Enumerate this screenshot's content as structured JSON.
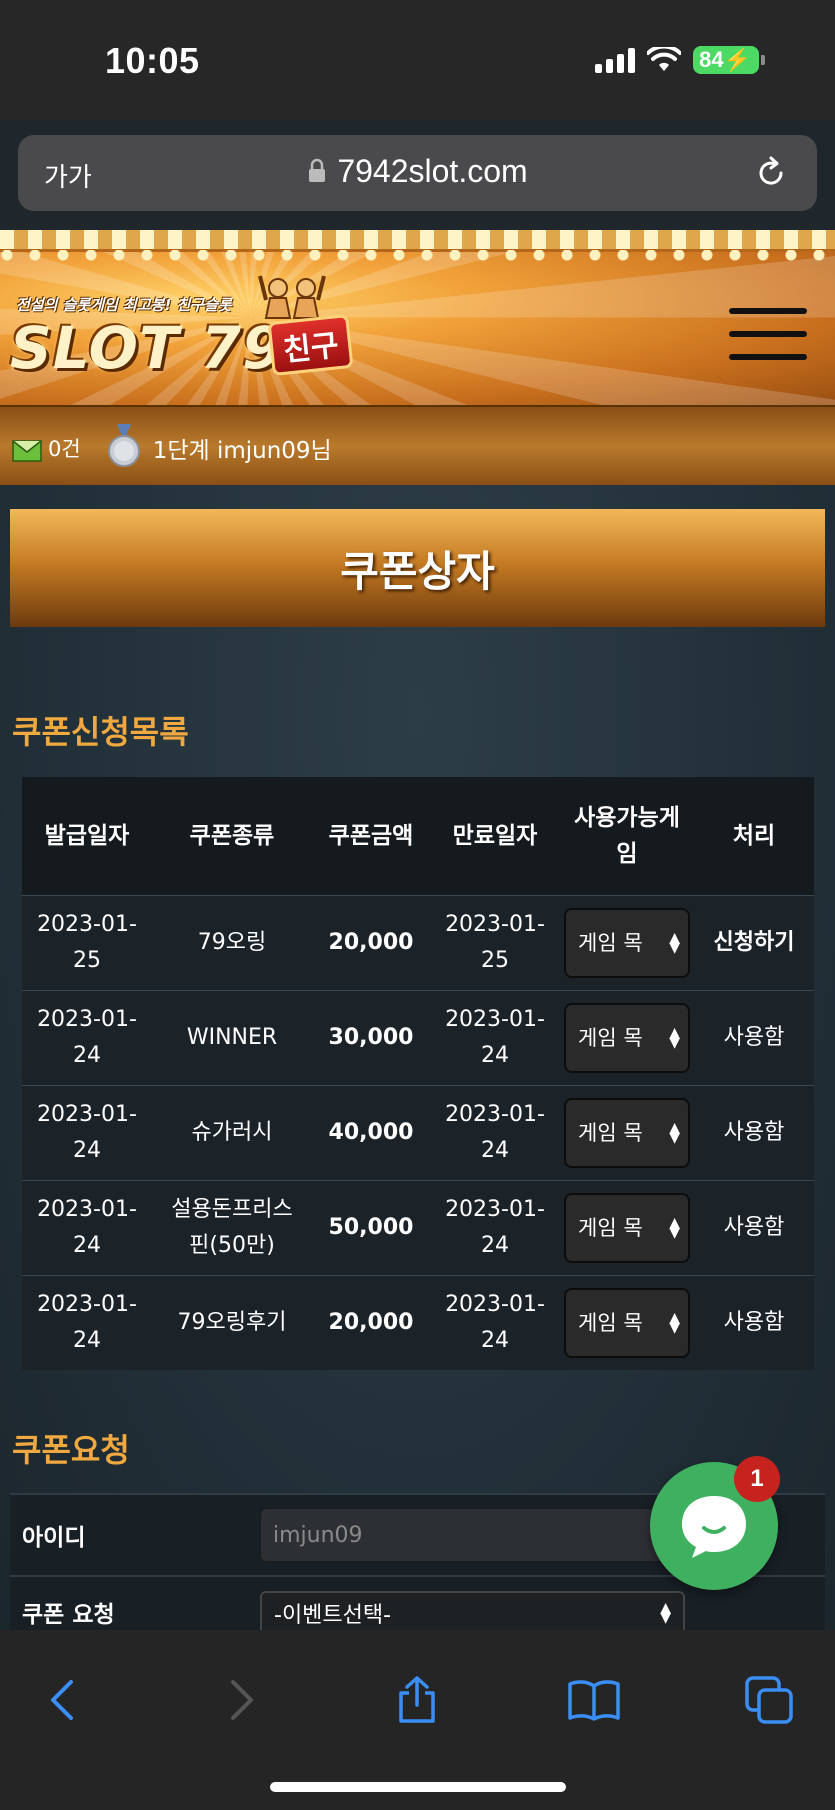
{
  "status_bar": {
    "time": "10:05",
    "battery": "84"
  },
  "browser": {
    "aa_label": "가가",
    "url": "7942slot.com"
  },
  "site": {
    "logo_tagline": "전설의 슬롯게임 최고봉! 친구슬롯",
    "logo_text": "SLOT 79",
    "logo_badge": "친구"
  },
  "user_bar": {
    "message_count": "0건",
    "user_text": "1단계 imjun09님"
  },
  "page": {
    "title": "쿠폰상자"
  },
  "coupon_list": {
    "section_title": "쿠폰신청목록",
    "headers": [
      "발급일자",
      "쿠폰종류",
      "쿠폰금액",
      "만료일자",
      "사용가능게임",
      "처리"
    ],
    "rows": [
      {
        "issued": "2023-01-25",
        "type": "79오링",
        "amount": "20,000",
        "expires": "2023-01-25",
        "game": "게임 목",
        "action": "신청하기"
      },
      {
        "issued": "2023-01-24",
        "type": "WINNER",
        "amount": "30,000",
        "expires": "2023-01-24",
        "game": "게임 목",
        "action": "사용함"
      },
      {
        "issued": "2023-01-24",
        "type": "슈가러시",
        "amount": "40,000",
        "expires": "2023-01-24",
        "game": "게임 목",
        "action": "사용함"
      },
      {
        "issued": "2023-01-24",
        "type": "설용돈프리스핀(50만)",
        "amount": "50,000",
        "expires": "2023-01-24",
        "game": "게임 목",
        "action": "사용함"
      },
      {
        "issued": "2023-01-24",
        "type": "79오링후기",
        "amount": "20,000",
        "expires": "2023-01-24",
        "game": "게임 목",
        "action": "사용함"
      }
    ]
  },
  "coupon_request": {
    "section_title": "쿠폰요청",
    "id_label": "아이디",
    "id_placeholder": "imjun09",
    "request_label": "쿠폰 요청",
    "request_selected": "-이벤트선택-"
  },
  "chat": {
    "badge_count": "1"
  },
  "colors": {
    "accent_orange": "#f0a840",
    "amount_teal": "#6fe7d9",
    "chat_green": "#3fb060",
    "badge_red": "#c6231f"
  },
  "icons": [
    "lock-icon",
    "reload-icon",
    "hamburger-icon",
    "mail-icon",
    "medal-icon",
    "chat-icon",
    "back-icon",
    "forward-icon",
    "share-icon",
    "bookmarks-icon",
    "tabs-icon"
  ]
}
